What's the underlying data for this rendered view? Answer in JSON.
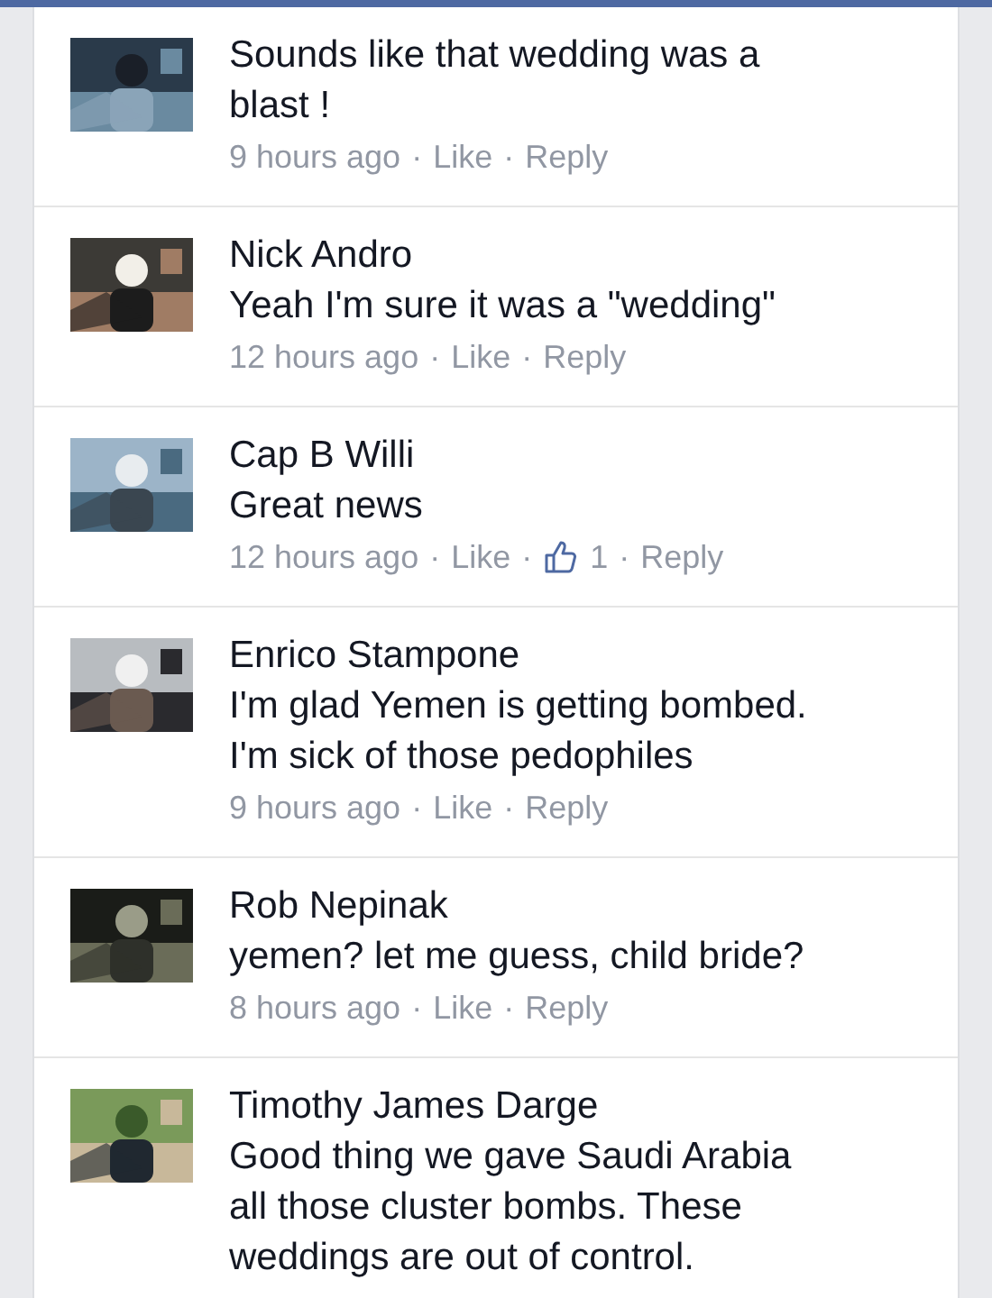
{
  "comments": [
    {
      "avatar": {
        "kind": "picture"
      },
      "text": [
        "Sounds like that wedding was a",
        "blast !"
      ],
      "meta": [
        {
          "kind": "time",
          "text": "9 hours ago"
        },
        {
          "kind": "sep",
          "text": "·"
        },
        {
          "kind": "link",
          "text": "Like"
        },
        {
          "kind": "sep",
          "text": "·"
        },
        {
          "kind": "link",
          "text": "Reply"
        }
      ]
    },
    {
      "avatar": {
        "kind": "picture"
      },
      "author": "Nick Andro",
      "text": [
        "Yeah I'm sure it was a \"wedding\""
      ],
      "meta": [
        {
          "kind": "time",
          "text": "12 hours ago"
        },
        {
          "kind": "sep",
          "text": "·"
        },
        {
          "kind": "link",
          "text": "Like"
        },
        {
          "kind": "sep",
          "text": "·"
        },
        {
          "kind": "link",
          "text": "Reply"
        }
      ]
    },
    {
      "avatar": {
        "kind": "picture"
      },
      "author": "Cap B Willi",
      "text": [
        "Great news"
      ],
      "meta": [
        {
          "kind": "time",
          "text": "12 hours ago"
        },
        {
          "kind": "sep",
          "text": "·"
        },
        {
          "kind": "link",
          "text": "Like"
        },
        {
          "kind": "sep",
          "text": "·"
        },
        {
          "kind": "likes",
          "text": "1"
        },
        {
          "kind": "sep",
          "text": "·"
        },
        {
          "kind": "link",
          "text": "Reply"
        }
      ]
    },
    {
      "avatar": {
        "kind": "picture"
      },
      "author": "Enrico Stampone",
      "text": [
        "I'm glad Yemen is getting bombed.",
        "I'm sick of those pedophiles"
      ],
      "meta": [
        {
          "kind": "time",
          "text": "9 hours ago"
        },
        {
          "kind": "sep",
          "text": "·"
        },
        {
          "kind": "link",
          "text": "Like"
        },
        {
          "kind": "sep",
          "text": "·"
        },
        {
          "kind": "link",
          "text": "Reply"
        }
      ]
    },
    {
      "avatar": {
        "kind": "picture"
      },
      "author": "Rob Nepinak",
      "text": [
        "yemen? let me guess, child bride?"
      ],
      "meta": [
        {
          "kind": "time",
          "text": "8 hours ago"
        },
        {
          "kind": "sep",
          "text": "·"
        },
        {
          "kind": "link",
          "text": "Like"
        },
        {
          "kind": "sep",
          "text": "·"
        },
        {
          "kind": "link",
          "text": "Reply"
        }
      ]
    },
    {
      "avatar": {
        "kind": "picture"
      },
      "author": "Timothy James Darge",
      "text": [
        "Good thing we gave Saudi Arabia",
        "all those cluster bombs. These",
        "weddings are out of control."
      ]
    }
  ]
}
